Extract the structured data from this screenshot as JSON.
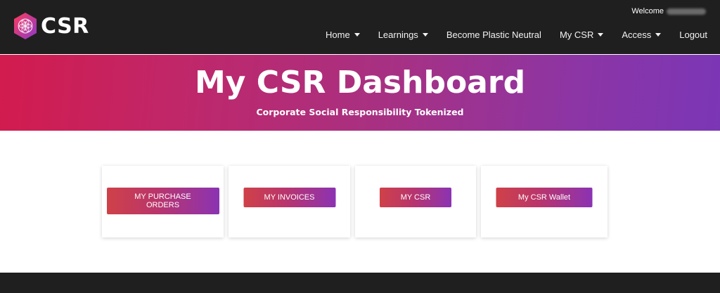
{
  "header": {
    "logo_text": "CSR",
    "welcome_label": "Welcome",
    "nav": [
      {
        "label": "Home",
        "dropdown": true
      },
      {
        "label": "Learnings",
        "dropdown": true
      },
      {
        "label": "Become Plastic Neutral",
        "dropdown": false
      },
      {
        "label": "My CSR",
        "dropdown": true
      },
      {
        "label": "Access",
        "dropdown": true
      },
      {
        "label": "Logout",
        "dropdown": false
      }
    ]
  },
  "hero": {
    "title": "My CSR Dashboard",
    "subtitle": "Corporate Social Responsibility Tokenized"
  },
  "cards": [
    {
      "button_label": "MY PURCHASE ORDERS"
    },
    {
      "button_label": "MY INVOICES"
    },
    {
      "button_label": "MY CSR"
    },
    {
      "button_label": "My CSR Wallet"
    }
  ],
  "colors": {
    "navbar_bg": "#1f1f1f",
    "hero_gradient_start": "#d21b4e",
    "hero_gradient_end": "#7b36b6",
    "button_gradient_start": "#cf4148",
    "button_gradient_end": "#8b33b3"
  }
}
